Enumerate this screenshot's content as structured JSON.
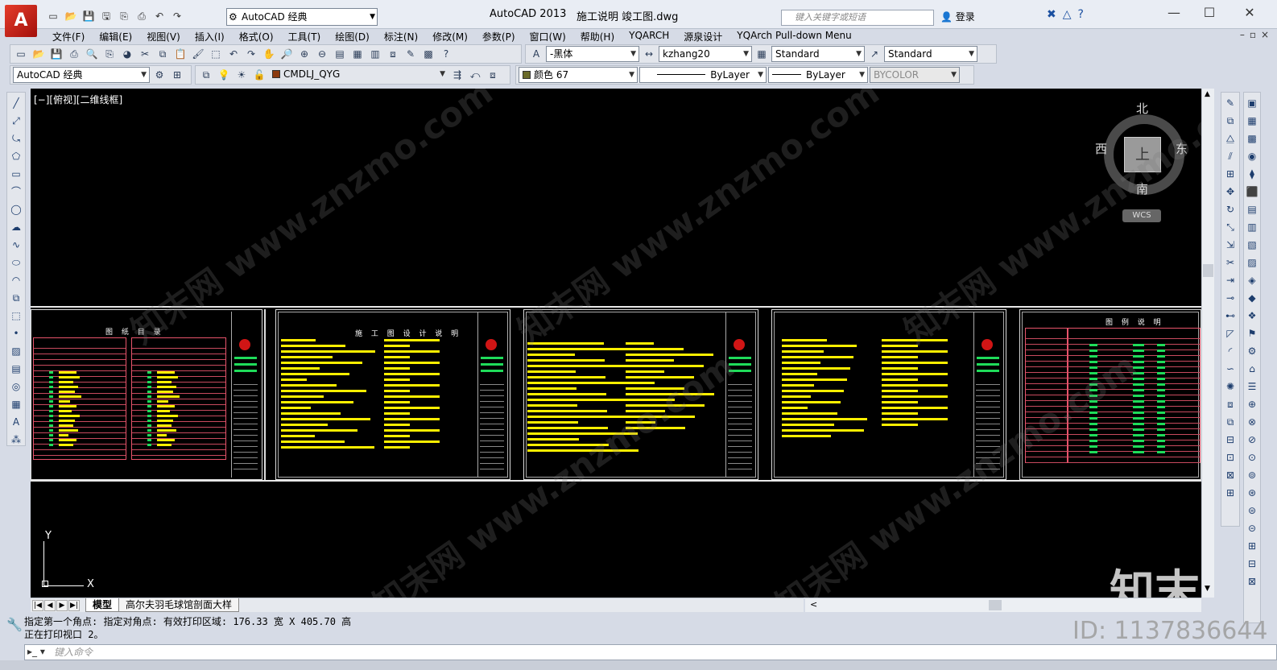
{
  "app": {
    "logo": "A",
    "title": "AutoCAD 2013",
    "file": "施工说明 竣工图.dwg",
    "workspace": "AutoCAD 经典",
    "search_placeholder": "键入关键字或短语",
    "login": "登录",
    "help": "?"
  },
  "menu": [
    "文件(F)",
    "编辑(E)",
    "视图(V)",
    "插入(I)",
    "格式(O)",
    "工具(T)",
    "绘图(D)",
    "标注(N)",
    "修改(M)",
    "参数(P)",
    "窗口(W)",
    "帮助(H)",
    "YQARCH",
    "源泉设计",
    "YQArch Pull-down Menu"
  ],
  "toolbar": {
    "text_font": "-黑体",
    "dim_style": "kzhang20",
    "table_style": "Standard",
    "multileader_style": "Standard",
    "workspace": "AutoCAD 经典",
    "layer": "CMDLJ_QYG",
    "color": "颜色 67",
    "linetype": "ByLayer",
    "lineweight": "ByLayer",
    "plotstyle": "BYCOLOR"
  },
  "colors": {
    "color67_swatch": "#6b6b2a",
    "layer_swatch": "#8b3a0f",
    "accent": "#e53d2b"
  },
  "canvas": {
    "view_label": "[−][俯视][二维线框]",
    "viewcube": {
      "north": "北",
      "south": "南",
      "east": "东",
      "west": "西",
      "face": "上",
      "wcs": "WCS"
    },
    "ucs": {
      "x": "X",
      "y": "Y"
    },
    "sheets": [
      {
        "title": "图 纸 目 录"
      },
      {
        "title": "施 工 图 设 计 说 明"
      },
      {
        "title": ""
      },
      {
        "title": ""
      },
      {
        "title": "图 例 说 明"
      }
    ],
    "watermark": "知末网 www.znzmo.com",
    "brand": "知末"
  },
  "tabs": {
    "model": "模型",
    "layout": "高尔夫羽毛球馆剖面大样"
  },
  "command": {
    "line1": "指定第一个角点: 指定对角点: 有效打印区域:   176.33 宽 X 405.70 高",
    "line2": "正在打印视口 2。",
    "input_placeholder": "键入命令"
  },
  "id_mark": "ID: 1137836644"
}
